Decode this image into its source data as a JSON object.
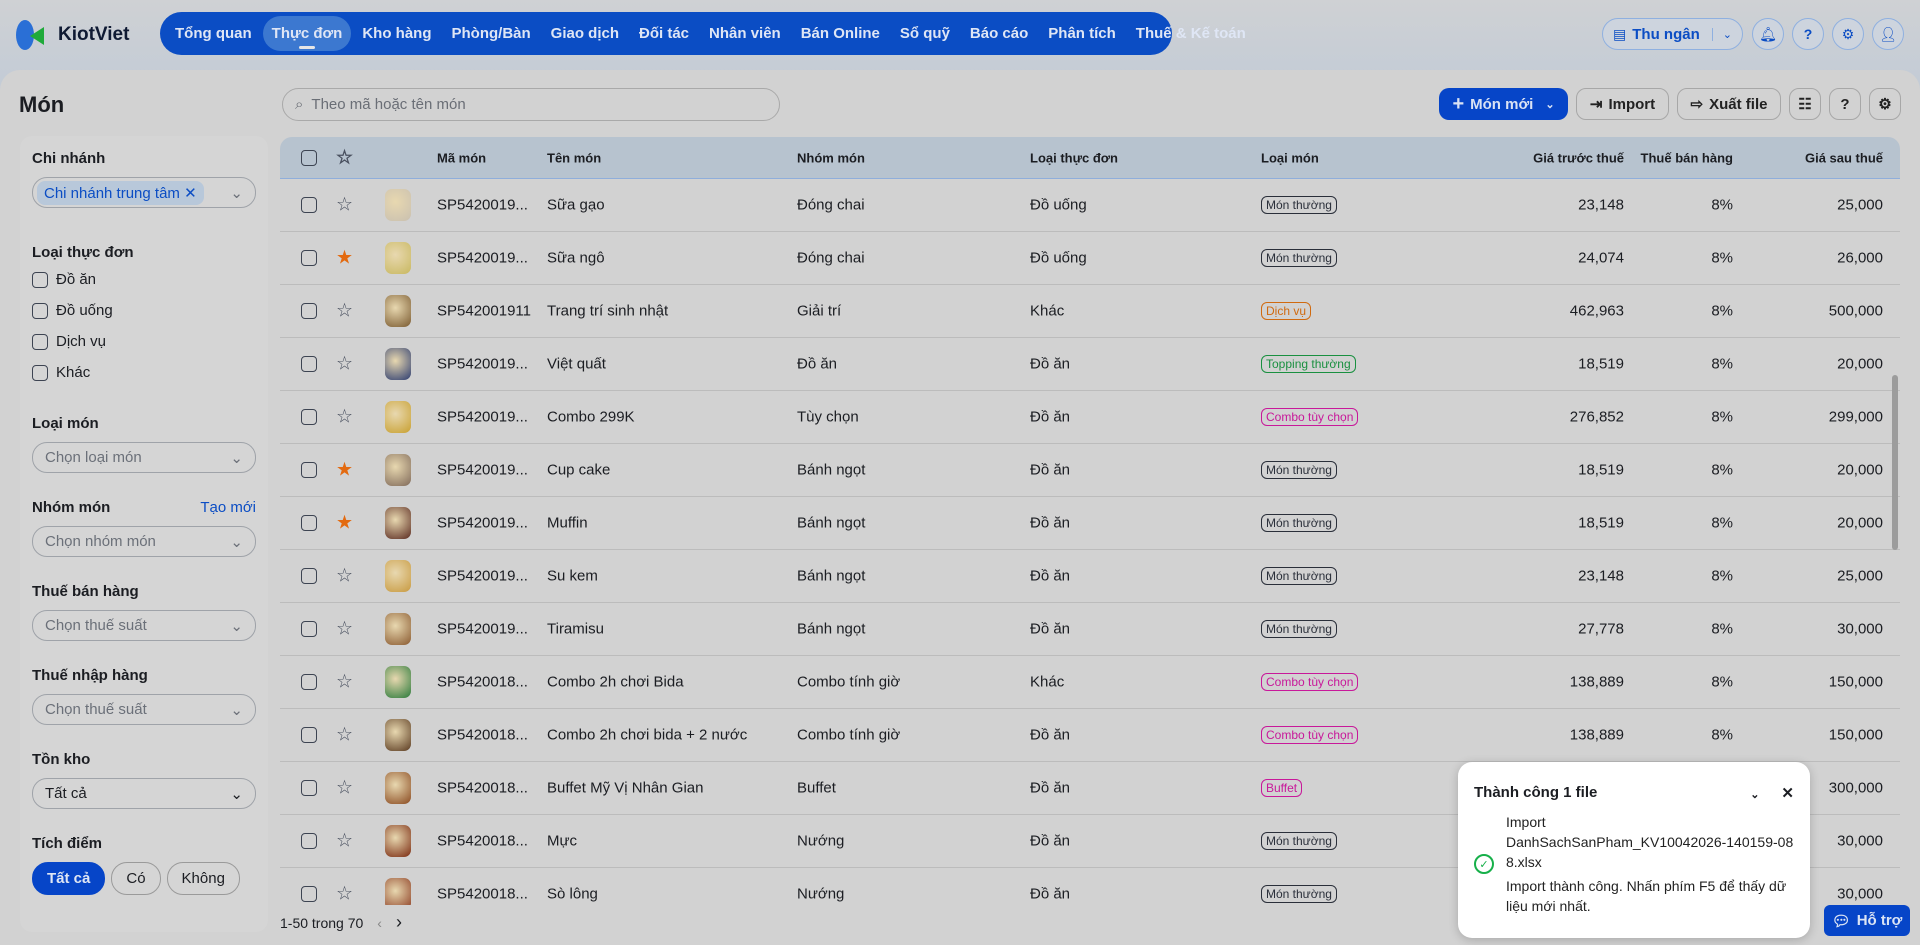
{
  "app": {
    "name": "KiotViet"
  },
  "nav": {
    "items": [
      "Tổng quan",
      "Thực đơn",
      "Kho hàng",
      "Phòng/Bàn",
      "Giao dịch",
      "Đối tác",
      "Nhân viên",
      "Bán Online",
      "Sổ quỹ",
      "Báo cáo",
      "Phân tích",
      "Thuế & Kế toán"
    ],
    "active": 1
  },
  "topbar": {
    "cashier": "Thu ngân"
  },
  "page": {
    "title": "Món",
    "search_placeholder": "Theo mã hoặc tên món",
    "new_button": "Món mới",
    "import": "Import",
    "export": "Xuất file"
  },
  "filters": {
    "branch_label": "Chi nhánh",
    "branch_chip": "Chi nhánh trung tâm",
    "menu_type_label": "Loại thực đơn",
    "menu_types": [
      "Đồ ăn",
      "Đồ uống",
      "Dịch vụ",
      "Khác"
    ],
    "item_type_label": "Loại món",
    "item_type_placeholder": "Chọn loại món",
    "group_label": "Nhóm món",
    "group_create": "Tạo mới",
    "group_placeholder": "Chọn nhóm món",
    "sales_tax_label": "Thuế bán hàng",
    "sales_tax_placeholder": "Chọn thuế suất",
    "import_tax_label": "Thuế nhập hàng",
    "import_tax_placeholder": "Chọn thuế suất",
    "stock_label": "Tồn kho",
    "stock_value": "Tất cả",
    "points_label": "Tích điểm",
    "points_options": [
      "Tất cả",
      "Có",
      "Không"
    ],
    "points_selected": 0
  },
  "table": {
    "headers": [
      "Mã món",
      "Tên món",
      "Nhóm món",
      "Loại thực đơn",
      "Loại món",
      "Giá trước thuế",
      "Thuế bán hàng",
      "Giá sau thuế"
    ],
    "rows": [
      {
        "code": "SP5420019...",
        "name": "Sữa gạo",
        "group": "Đóng chai",
        "menu": "Đồ uống",
        "type": "Món thường",
        "tag": "gray",
        "pre": "23,148",
        "tax": "8%",
        "post": "25,000",
        "fav": false,
        "img": "#c9c0b0"
      },
      {
        "code": "SP5420019...",
        "name": "Sữa ngô",
        "group": "Đóng chai",
        "menu": "Đồ uống",
        "type": "Món thường",
        "tag": "gray",
        "pre": "24,074",
        "tax": "8%",
        "post": "26,000",
        "fav": true,
        "img": "#c8b860"
      },
      {
        "code": "SP542001911",
        "name": "Trang trí sinh nhật",
        "group": "Giải trí",
        "menu": "Khác",
        "type": "Dịch vụ",
        "tag": "orange",
        "pre": "462,963",
        "tax": "8%",
        "post": "500,000",
        "fav": false,
        "img": "#7a5a30"
      },
      {
        "code": "SP5420019...",
        "name": "Việt quất",
        "group": "Đồ ăn",
        "menu": "Đồ ăn",
        "type": "Topping thường",
        "tag": "green",
        "pre": "18,519",
        "tax": "8%",
        "post": "20,000",
        "fav": false,
        "img": "#2c3c70"
      },
      {
        "code": "SP5420019...",
        "name": "Combo 299K",
        "group": "Tùy chọn",
        "menu": "Đồ ăn",
        "type": "Combo tùy chọn",
        "tag": "pink",
        "pre": "276,852",
        "tax": "8%",
        "post": "299,000",
        "fav": false,
        "img": "#c8a030"
      },
      {
        "code": "SP5420019...",
        "name": "Cup cake",
        "group": "Bánh ngọt",
        "menu": "Đồ ăn",
        "type": "Món thường",
        "tag": "gray",
        "pre": "18,519",
        "tax": "8%",
        "post": "20,000",
        "fav": true,
        "img": "#806a5a"
      },
      {
        "code": "SP5420019...",
        "name": "Muffin",
        "group": "Bánh ngọt",
        "menu": "Đồ ăn",
        "type": "Món thường",
        "tag": "gray",
        "pre": "18,519",
        "tax": "8%",
        "post": "20,000",
        "fav": true,
        "img": "#5a2a20"
      },
      {
        "code": "SP5420019...",
        "name": "Su kem",
        "group": "Bánh ngọt",
        "menu": "Đồ ăn",
        "type": "Món thường",
        "tag": "gray",
        "pre": "23,148",
        "tax": "8%",
        "post": "25,000",
        "fav": false,
        "img": "#c89a40"
      },
      {
        "code": "SP5420019...",
        "name": "Tiramisu",
        "group": "Bánh ngọt",
        "menu": "Đồ ăn",
        "type": "Món thường",
        "tag": "gray",
        "pre": "27,778",
        "tax": "8%",
        "post": "30,000",
        "fav": false,
        "img": "#8a5a30"
      },
      {
        "code": "SP5420018...",
        "name": "Combo 2h chơi Bida",
        "group": "Combo tính giờ",
        "menu": "Khác",
        "type": "Combo tùy chọn",
        "tag": "pink",
        "pre": "138,889",
        "tax": "8%",
        "post": "150,000",
        "fav": false,
        "img": "#2a7a3a"
      },
      {
        "code": "SP5420018...",
        "name": "Combo 2h chơi bida + 2 nước",
        "group": "Combo tính giờ",
        "menu": "Đồ ăn",
        "type": "Combo tùy chọn",
        "tag": "pink",
        "pre": "138,889",
        "tax": "8%",
        "post": "150,000",
        "fav": false,
        "img": "#5a3a20"
      },
      {
        "code": "SP5420018...",
        "name": "Buffet Mỹ Vị Nhân Gian",
        "group": "Buffet",
        "menu": "Đồ ăn",
        "type": "Buffet",
        "tag": "pink",
        "pre": "",
        "tax": "",
        "post": "300,000",
        "fav": false,
        "img": "#8a4a20"
      },
      {
        "code": "SP5420018...",
        "name": "Mực",
        "group": "Nướng",
        "menu": "Đồ ăn",
        "type": "Món thường",
        "tag": "gray",
        "pre": "",
        "tax": "",
        "post": "30,000",
        "fav": false,
        "img": "#7a2a10"
      },
      {
        "code": "SP5420018...",
        "name": "Sò lông",
        "group": "Nướng",
        "menu": "Đồ ăn",
        "type": "Món thường",
        "tag": "gray",
        "pre": "",
        "tax": "",
        "post": "30,000",
        "fav": false,
        "img": "#8a3a20"
      }
    ],
    "pagination": "1-50 trong 70"
  },
  "tag_colors": {
    "gray": "#2a2f3a",
    "orange": "#d06a10",
    "green": "#1a9040",
    "pink": "#c8189a"
  },
  "toast": {
    "title": "Thành công 1 file",
    "heading": "Import",
    "filename": "DanhSachSanPham_KV10042026-140159-088.xlsx",
    "message": "Import thành công. Nhấn phím F5 để thấy dữ liệu mới nhất."
  },
  "help": {
    "label": "Hỗ trợ"
  }
}
